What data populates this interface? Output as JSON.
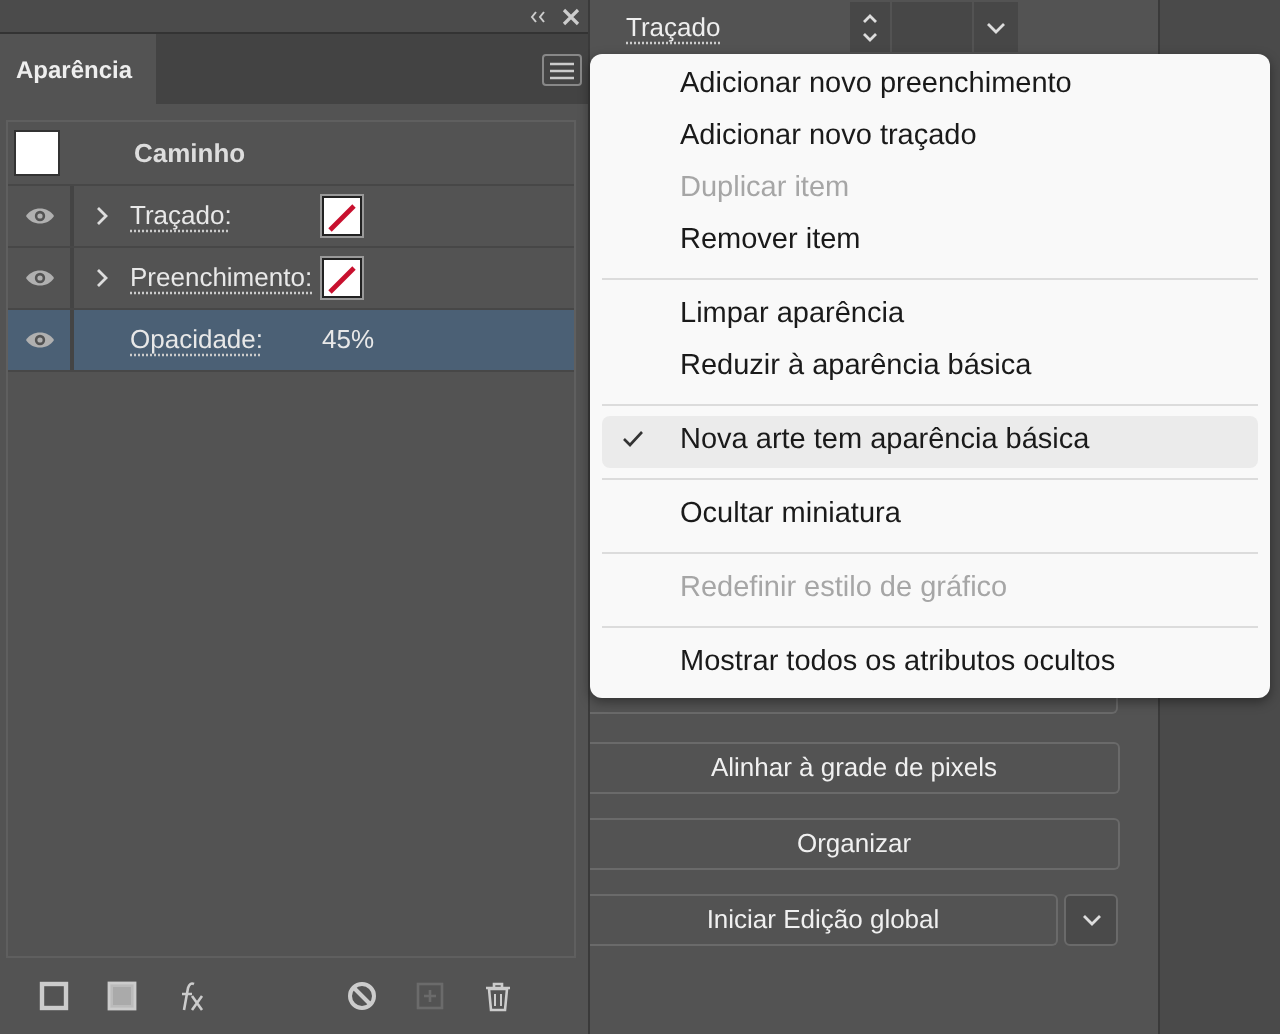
{
  "panel": {
    "tabs": [
      {
        "label": "Aparência",
        "selected": true
      }
    ],
    "object_title": "Caminho",
    "rows": [
      {
        "kind": "swatch",
        "label": "Traçado:",
        "visible": true,
        "expandable": true,
        "selected": false
      },
      {
        "kind": "swatch",
        "label": "Preenchimento:",
        "visible": true,
        "expandable": true,
        "selected": false
      },
      {
        "kind": "value",
        "label": "Opacidade:",
        "value": "45%",
        "visible": true,
        "expandable": false,
        "selected": true
      }
    ],
    "footer_icons": [
      {
        "kind": "stroke",
        "disabled": false
      },
      {
        "kind": "fill",
        "disabled": false
      },
      {
        "kind": "fx",
        "disabled": false
      },
      {
        "kind": "clear",
        "disabled": false
      },
      {
        "kind": "duplicate",
        "disabled": true
      },
      {
        "kind": "delete",
        "disabled": false
      }
    ]
  },
  "properties": {
    "stroke_label": "Traçado",
    "buttons": [
      {
        "label": "Alinhar à grade de pixels",
        "dropdown": false
      },
      {
        "label": "Organizar",
        "dropdown": false
      },
      {
        "label": "Iniciar Edição global",
        "dropdown": true
      }
    ]
  },
  "menu": [
    {
      "kind": "item",
      "label": "Adicionar novo preenchimento",
      "disabled": false,
      "checked": false,
      "selected": false
    },
    {
      "kind": "item",
      "label": "Adicionar novo traçado",
      "disabled": false,
      "checked": false,
      "selected": false
    },
    {
      "kind": "item",
      "label": "Duplicar item",
      "disabled": true,
      "checked": false,
      "selected": false
    },
    {
      "kind": "item",
      "label": "Remover item",
      "disabled": false,
      "checked": false,
      "selected": false
    },
    {
      "kind": "separator"
    },
    {
      "kind": "item",
      "label": "Limpar aparência",
      "disabled": false,
      "checked": false,
      "selected": false
    },
    {
      "kind": "item",
      "label": "Reduzir à aparência básica",
      "disabled": false,
      "checked": false,
      "selected": false
    },
    {
      "kind": "separator"
    },
    {
      "kind": "item",
      "label": "Nova arte tem aparência básica",
      "disabled": false,
      "checked": true,
      "selected": true
    },
    {
      "kind": "separator"
    },
    {
      "kind": "item",
      "label": "Ocultar miniatura",
      "disabled": false,
      "checked": false,
      "selected": false
    },
    {
      "kind": "separator"
    },
    {
      "kind": "item",
      "label": "Redefinir estilo de gráfico",
      "disabled": true,
      "checked": false,
      "selected": false
    },
    {
      "kind": "separator"
    },
    {
      "kind": "item",
      "label": "Mostrar todos os atributos ocultos",
      "disabled": false,
      "checked": false,
      "selected": false
    }
  ]
}
